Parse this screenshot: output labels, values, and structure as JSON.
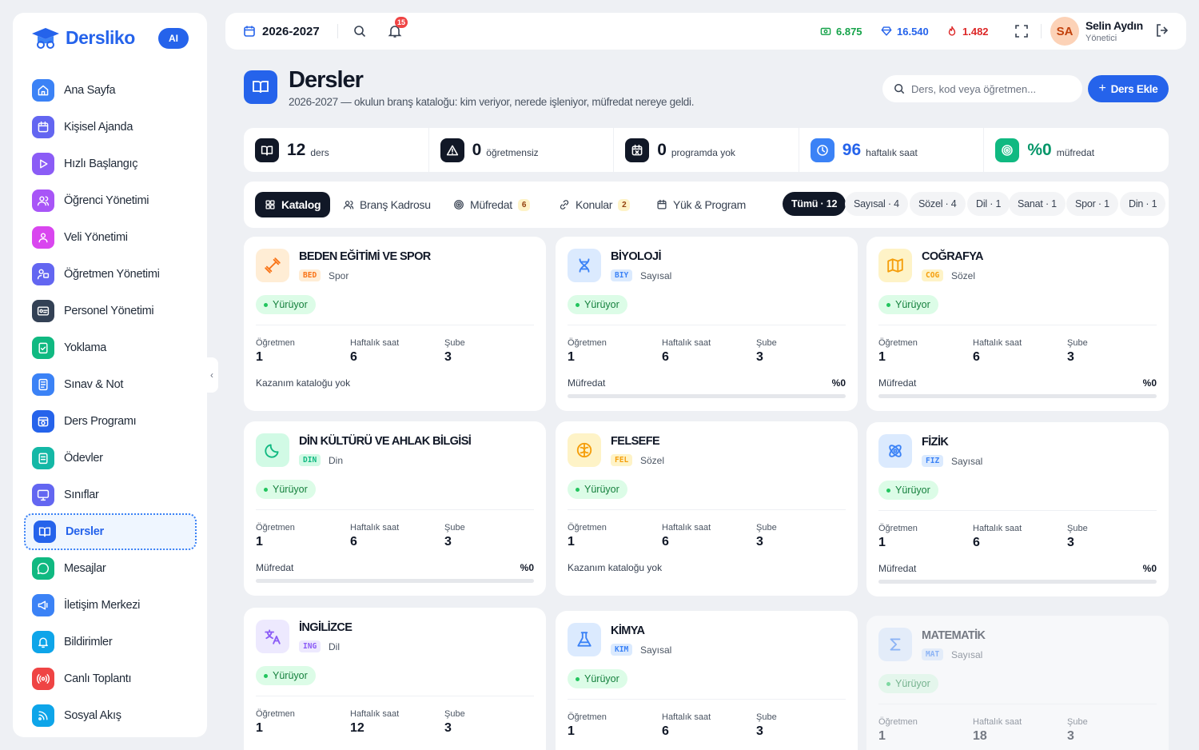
{
  "brand": {
    "name": "Dersliko",
    "ai_label": "AI"
  },
  "sidebar": {
    "items": [
      {
        "label": "Ana Sayfa",
        "icon": "home-icon",
        "color": "#3b82f6"
      },
      {
        "label": "Kişisel Ajanda",
        "icon": "calendar-icon",
        "color": "#6366f1"
      },
      {
        "label": "Hızlı Başlangıç",
        "icon": "play-icon",
        "color": "#8b5cf6"
      },
      {
        "label": "Öğrenci Yönetimi",
        "icon": "users-icon",
        "color": "#a855f7"
      },
      {
        "label": "Veli Yönetimi",
        "icon": "user-group-icon",
        "color": "#d946ef"
      },
      {
        "label": "Öğretmen Yönetimi",
        "icon": "teacher-icon",
        "color": "#6366f1"
      },
      {
        "label": "Personel Yönetimi",
        "icon": "id-card-icon",
        "color": "#334155"
      },
      {
        "label": "Yoklama",
        "icon": "clipboard-check-icon",
        "color": "#10b981"
      },
      {
        "label": "Sınav & Not",
        "icon": "exam-icon",
        "color": "#3b82f6"
      },
      {
        "label": "Ders Programı",
        "icon": "schedule-icon",
        "color": "#2563eb"
      },
      {
        "label": "Ödevler",
        "icon": "homework-icon",
        "color": "#14b8a6"
      },
      {
        "label": "Sınıflar",
        "icon": "classroom-icon",
        "color": "#6366f1"
      },
      {
        "label": "Dersler",
        "icon": "book-open-icon",
        "color": "#2563eb",
        "active": true
      },
      {
        "label": "Mesajlar",
        "icon": "message-icon",
        "color": "#10b981"
      },
      {
        "label": "İletişim Merkezi",
        "icon": "megaphone-icon",
        "color": "#3b82f6"
      },
      {
        "label": "Bildirimler",
        "icon": "bell-icon",
        "color": "#0ea5e9"
      },
      {
        "label": "Canlı Toplantı",
        "icon": "broadcast-icon",
        "color": "#ef4444"
      },
      {
        "label": "Sosyal Akış",
        "icon": "rss-icon",
        "color": "#0ea5e9"
      }
    ]
  },
  "topbar": {
    "year": "2026-2027",
    "notifications": "15",
    "stats": [
      {
        "value": "6.875",
        "color": "#16a34a",
        "icon": "money-icon"
      },
      {
        "value": "16.540",
        "color": "#2563eb",
        "icon": "gem-icon"
      },
      {
        "value": "1.482",
        "color": "#dc2626",
        "icon": "fire-icon"
      }
    ],
    "user": {
      "initials": "SA",
      "name": "Selin Aydın",
      "role": "Yönetici"
    }
  },
  "header": {
    "title": "Dersler",
    "subtitle": "2026-2027 — okulun branş kataloğu: kim veriyor, nerede işleniyor, müfredat nereye geldi.",
    "search_placeholder": "Ders, kod veya öğretmen...",
    "add_label": "Ders Ekle"
  },
  "kpis": [
    {
      "value": "12",
      "label": "ders",
      "color": "#111827",
      "value_color": "#111827",
      "icon": "book-icon"
    },
    {
      "value": "0",
      "label": "öğretmensiz",
      "color": "#111827",
      "value_color": "#111827",
      "icon": "warning-icon"
    },
    {
      "value": "0",
      "label": "programda yok",
      "color": "#111827",
      "value_color": "#111827",
      "icon": "calendar-x-icon"
    },
    {
      "value": "96",
      "label": "haftalık saat",
      "color": "#3b82f6",
      "value_color": "#2563eb",
      "icon": "clock-icon"
    },
    {
      "value": "%0",
      "label": "müfredat",
      "color": "#10b981",
      "value_color": "#059669",
      "icon": "target-icon"
    }
  ],
  "tabs": [
    {
      "label": "Katalog",
      "icon": "grid-icon",
      "active": true
    },
    {
      "label": "Branş Kadrosu",
      "icon": "users-icon"
    },
    {
      "label": "Müfredat",
      "icon": "target-icon",
      "count": "6"
    },
    {
      "label": "Konular",
      "icon": "link-icon",
      "count": "2"
    },
    {
      "label": "Yük & Program",
      "icon": "calendar-icon"
    }
  ],
  "filters": [
    "Tümü · 12",
    "Sayısal · 4",
    "Sözel · 4",
    "Dil · 1",
    "Sanat · 1",
    "Spor · 1",
    "Din · 1"
  ],
  "card_labels": {
    "teacher": "Öğretmen",
    "hours": "Haftalık saat",
    "branch": "Şube",
    "curriculum": "Müfredat",
    "no_catalog": "Kazanım kataloğu yok"
  },
  "courses": [
    {
      "name": "BEDEN EĞİTİMİ VE SPOR",
      "code": "BED",
      "area": "Spor",
      "status": "Yürüyor",
      "teacher": "1",
      "hours": "6",
      "branch": "3",
      "footer": "none",
      "accent": "#f97316",
      "bg": "#ffedd5",
      "icon": "dumbbell-icon"
    },
    {
      "name": "BİYOLOJİ",
      "code": "BIY",
      "area": "Sayısal",
      "status": "Yürüyor",
      "teacher": "1",
      "hours": "6",
      "branch": "3",
      "footer": "progress",
      "pct": "%0",
      "progress": 0,
      "accent": "#3b82f6",
      "bg": "#dbeafe",
      "icon": "dna-icon"
    },
    {
      "name": "COĞRAFYA",
      "code": "COG",
      "area": "Sözel",
      "status": "Yürüyor",
      "teacher": "1",
      "hours": "6",
      "branch": "3",
      "footer": "progress",
      "pct": "%0",
      "progress": 0,
      "accent": "#f59e0b",
      "bg": "#fef3c7",
      "icon": "map-icon"
    },
    {
      "name": "DİN KÜLTÜRÜ VE AHLAK BİLGİSİ",
      "code": "DIN",
      "area": "Din",
      "status": "Yürüyor",
      "teacher": "1",
      "hours": "6",
      "branch": "3",
      "footer": "progress",
      "pct": "%0",
      "progress": 0,
      "accent": "#10b981",
      "bg": "#d1fae5",
      "icon": "moon-icon"
    },
    {
      "name": "FELSEFE",
      "code": "FEL",
      "area": "Sözel",
      "status": "Yürüyor",
      "teacher": "1",
      "hours": "6",
      "branch": "3",
      "footer": "none",
      "accent": "#f59e0b",
      "bg": "#fef3c7",
      "icon": "brain-icon"
    },
    {
      "name": "FİZİK",
      "code": "FIZ",
      "area": "Sayısal",
      "status": "Yürüyor",
      "teacher": "1",
      "hours": "6",
      "branch": "3",
      "footer": "progress",
      "pct": "%0",
      "progress": 0,
      "accent": "#3b82f6",
      "bg": "#dbeafe",
      "icon": "atom-icon"
    },
    {
      "name": "İNGİLİZCE",
      "code": "ING",
      "area": "Dil",
      "status": "Yürüyor",
      "teacher": "1",
      "hours": "12",
      "branch": "3",
      "footer": "none",
      "accent": "#8b5cf6",
      "bg": "#ede9fe",
      "icon": "translate-icon"
    },
    {
      "name": "KİMYA",
      "code": "KIM",
      "area": "Sayısal",
      "status": "Yürüyor",
      "teacher": "1",
      "hours": "6",
      "branch": "3",
      "footer": "none",
      "accent": "#3b82f6",
      "bg": "#dbeafe",
      "icon": "flask-icon"
    },
    {
      "name": "MATEMATİK",
      "code": "MAT",
      "area": "Sayısal",
      "status": "Yürüyor",
      "teacher": "1",
      "hours": "18",
      "branch": "3",
      "footer": "none",
      "accent": "#3b82f6",
      "bg": "#dbeafe",
      "icon": "sigma-icon",
      "dim": true
    }
  ]
}
